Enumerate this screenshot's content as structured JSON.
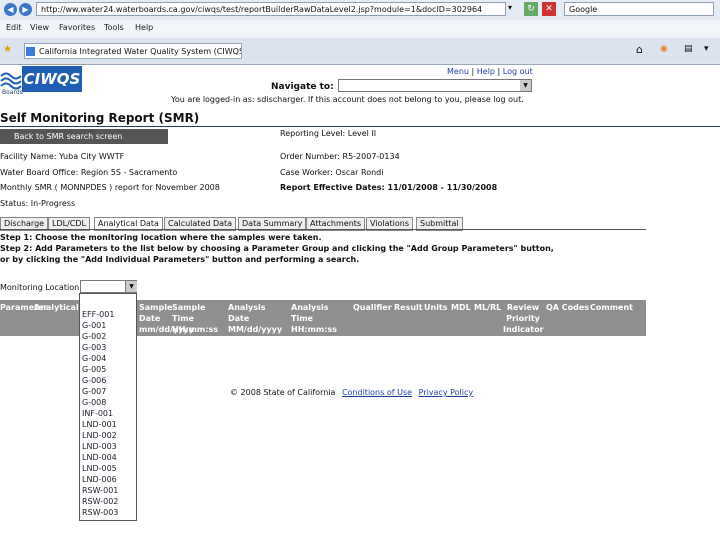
{
  "browser": {
    "url": "http://ww.water24.waterboards.ca.gov/ciwqs/test/reportBuilderRawDataLevel2.jsp?module=1&docID=302964",
    "search_value": "Google",
    "menu": [
      "Edit",
      "View",
      "Favorites",
      "Tools",
      "Help"
    ],
    "tab_title": "California Integrated Water Quality System (CIWQS)"
  },
  "header": {
    "logo_text": "CIWQS",
    "logo_sub": "Boards",
    "menu_link": "Menu",
    "help_link": "Help",
    "logout_link": "Log out",
    "navigate_label": "Navigate to:",
    "logged_in_text": "You are logged-in as: sdischarger. If this account does not belong to you, please log out."
  },
  "page": {
    "title": "Self Monitoring Report (SMR)",
    "back_button": "Back to SMR search screen",
    "facility": "Facility Name: Yuba City WWTF",
    "regional_board": "Water Board Office: Region 5S - Sacramento",
    "report_desc": "Monthly SMR ( MONNPDES ) report for November 2008",
    "status": "Status: In-Progress",
    "reporting_level": "Reporting Level: Level II",
    "order_number": "Order Number: R5-2007-0134",
    "case_worker": "Case Worker: Oscar Rondi",
    "effective_dates": "Report Effective Dates: 11/01/2008 - 11/30/2008"
  },
  "tabs": [
    "Discharge",
    "LDL/CDL",
    "Analytical Data",
    "Calculated Data",
    "Data Summary",
    "Attachments",
    "Violations",
    "Submittal"
  ],
  "steps": {
    "step1": "Step 1: Choose the monitoring location where the samples were taken.",
    "step2": "Step 2: Add Parameters to the list below by choosing a Parameter Group and clicking the \"Add Group Parameters\" button,",
    "step2b": "or by clicking the \"Add Individual Parameters\" button and performing a search."
  },
  "monitoring": {
    "label": "Monitoring Location:",
    "options": [
      "EFF-001",
      "G-001",
      "G-002",
      "G-003",
      "G-004",
      "G-005",
      "G-006",
      "G-007",
      "G-008",
      "INF-001",
      "LND-001",
      "LND-002",
      "LND-003",
      "LND-004",
      "LND-005",
      "LND-006",
      "RSW-001",
      "RSW-002",
      "RSW-003"
    ]
  },
  "table": {
    "headers": [
      "Parameter",
      "Analytical Method",
      "Sample Date mm/dd/yyyy",
      "Sample Time HH:mm:ss",
      "Analysis Date MM/dd/yyyy",
      "Analysis Time HH:mm:ss",
      "Qualifier",
      "Result",
      "Units",
      "MDL",
      "ML/RL",
      "Review Priority Indicator",
      "QA Codes",
      "Comment"
    ]
  },
  "footer": {
    "copyright": "© 2008 State of California",
    "conditions": "Conditions of Use",
    "privacy": "Privacy Policy"
  }
}
